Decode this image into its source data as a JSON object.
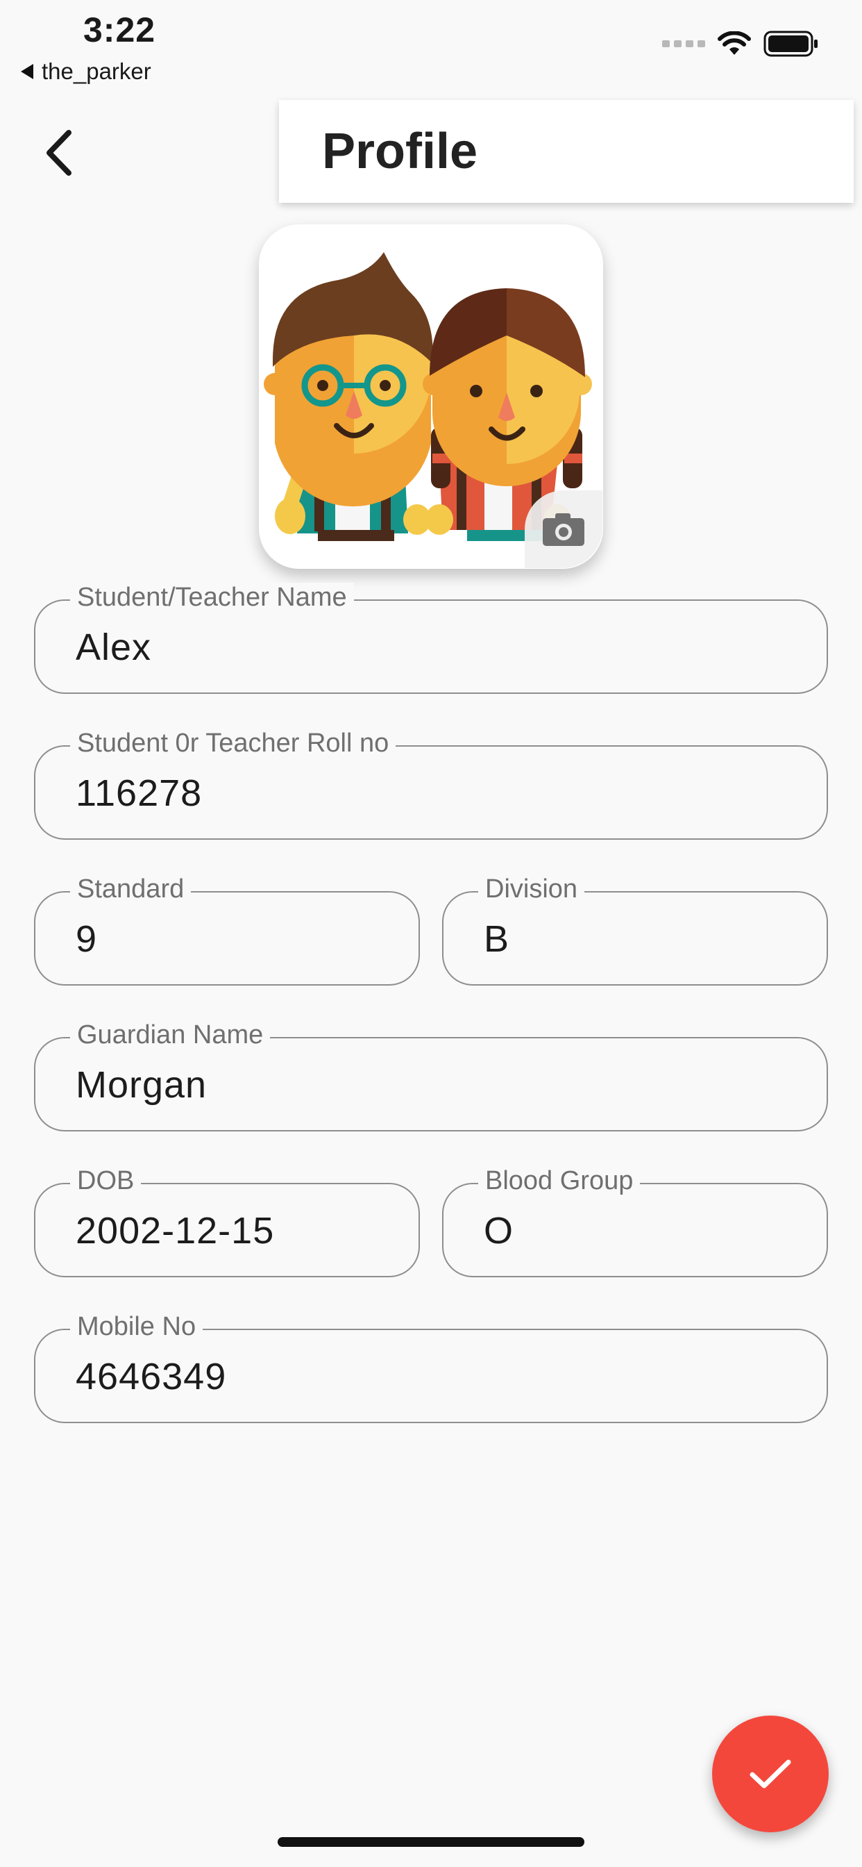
{
  "status_bar": {
    "time": "3:22",
    "back_app": "the_parker",
    "icons": [
      "signal-icon",
      "wifi-icon",
      "battery-icon"
    ]
  },
  "app_bar": {
    "title": "Profile",
    "back_icon": "chevron-left-icon"
  },
  "avatar": {
    "image": "students-illustration",
    "camera_icon": "camera-icon"
  },
  "form": {
    "name": {
      "label": "Student/Teacher Name",
      "value": "Alex"
    },
    "roll": {
      "label": "Student 0r Teacher Roll no",
      "value": "116278"
    },
    "standard": {
      "label": "Standard",
      "value": "9"
    },
    "division": {
      "label": "Division",
      "value": "B"
    },
    "guardian": {
      "label": "Guardian Name",
      "value": "Morgan"
    },
    "dob": {
      "label": "DOB",
      "value": "2002-12-15"
    },
    "blood_group": {
      "label": "Blood Group",
      "value": "O"
    },
    "mobile": {
      "label": "Mobile No",
      "value": "4646349"
    }
  },
  "fab": {
    "icon": "check-icon"
  },
  "colors": {
    "background": "#f9f9f9",
    "fab": "#f4473c",
    "field_border": "#8e8e8e",
    "label": "#6f6f6f"
  }
}
